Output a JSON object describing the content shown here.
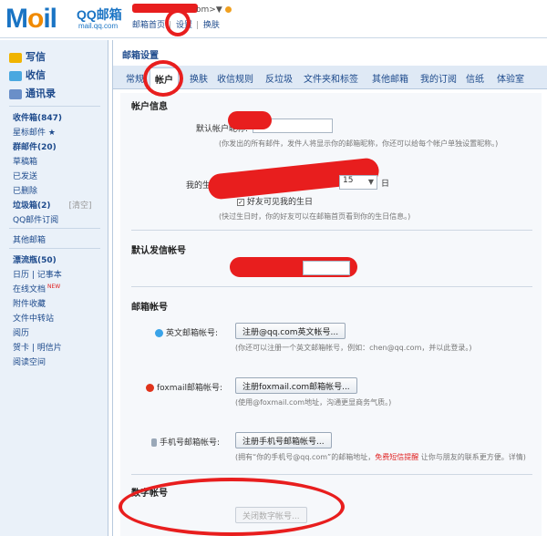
{
  "header": {
    "logo_main": "M",
    "logo_o": "o",
    "logo_rest": "il",
    "logo_qq": "QQ邮箱",
    "logo_url": "mail.qq.com",
    "user_email_suffix": "om>▼",
    "nav": [
      "邮箱首页",
      "设置",
      "换肤"
    ]
  },
  "sidebar": {
    "quick": [
      {
        "label": "写信",
        "icon": "pencil-icon",
        "color": "#f0b400"
      },
      {
        "label": "收信",
        "icon": "inbox-icon",
        "color": "#4aa8e0"
      },
      {
        "label": "通讯录",
        "icon": "contacts-icon",
        "color": "#6a8fc8"
      }
    ],
    "folders": [
      {
        "label": "收件箱(847)",
        "bold": true
      },
      {
        "label": "星标邮件 ★",
        "bold": false
      },
      {
        "label": "群邮件(20)",
        "bold": true
      },
      {
        "label": "草稿箱",
        "bold": false
      },
      {
        "label": "已发送",
        "bold": false
      },
      {
        "label": "已删除",
        "bold": false
      },
      {
        "label": "垃圾箱(2)",
        "bold": true,
        "extra": "[清空]"
      },
      {
        "label": "QQ邮件订阅",
        "bold": false
      }
    ],
    "other": "其他邮箱",
    "tools": [
      {
        "label": "漂流瓶(50)",
        "bold": true
      },
      {
        "label": "日历 | 记事本",
        "bold": false
      },
      {
        "label": "在线文档",
        "bold": false,
        "badge": "NEW"
      },
      {
        "label": "附件收藏",
        "bold": false
      },
      {
        "label": "文件中转站",
        "bold": false
      },
      {
        "label": "阅历",
        "bold": false
      },
      {
        "label": "贺卡 | 明信片",
        "bold": false
      },
      {
        "label": "阅读空间",
        "bold": false
      }
    ]
  },
  "main": {
    "title": "邮箱设置",
    "tabs": [
      "常规",
      "帐户",
      "换肤",
      "收信规则",
      "反垃圾",
      "文件夹和标签",
      "其他邮箱",
      "我的订阅",
      "信纸",
      "体验室"
    ],
    "active_tab": "帐户",
    "account_info": {
      "title": "帐户信息",
      "nickname_label": "默认帐户昵称:",
      "nickname_hint": "(你发出的所有邮件，发件人将显示你的邮箱昵称，你还可以给每个帐户单独设置昵称。)",
      "birthday_label": "我的生",
      "birthday_day": "15",
      "birthday_suffix": "日",
      "birthday_check": "好友可见我的生日",
      "birthday_hint": "(快过生日时，你的好友可以在邮箱首页看到你的生日信息。)"
    },
    "default_sender": {
      "title": "默认发信帐号"
    },
    "mail_accounts": {
      "title": "邮箱帐号",
      "english_label": "英文邮箱帐号:",
      "english_btn": "注册@qq.com英文帐号...",
      "english_hint": "(你还可以注册一个英文邮箱帐号，例如：chen@qq.com，并以此登录。)",
      "foxmail_label": "foxmail邮箱帐号:",
      "foxmail_btn": "注册foxmail.com邮箱帐号...",
      "foxmail_hint": "(使用@foxmail.com地址，沟通更显商务气质。)",
      "mobile_label": "手机号邮箱帐号:",
      "mobile_btn": "注册手机号邮箱帐号...",
      "mobile_hint_a": "(拥有“你的手机号@qq.com”的邮箱地址，",
      "mobile_hint_warn": "免费短信提醒",
      "mobile_hint_b": " 让你与朋友的联系更方便。详情)"
    },
    "digital_account": {
      "title": "数字帐号",
      "btn": "关闭数字帐号..."
    }
  },
  "colors": {
    "brand": "#1a74c4",
    "annotation": "#e81e1e"
  }
}
